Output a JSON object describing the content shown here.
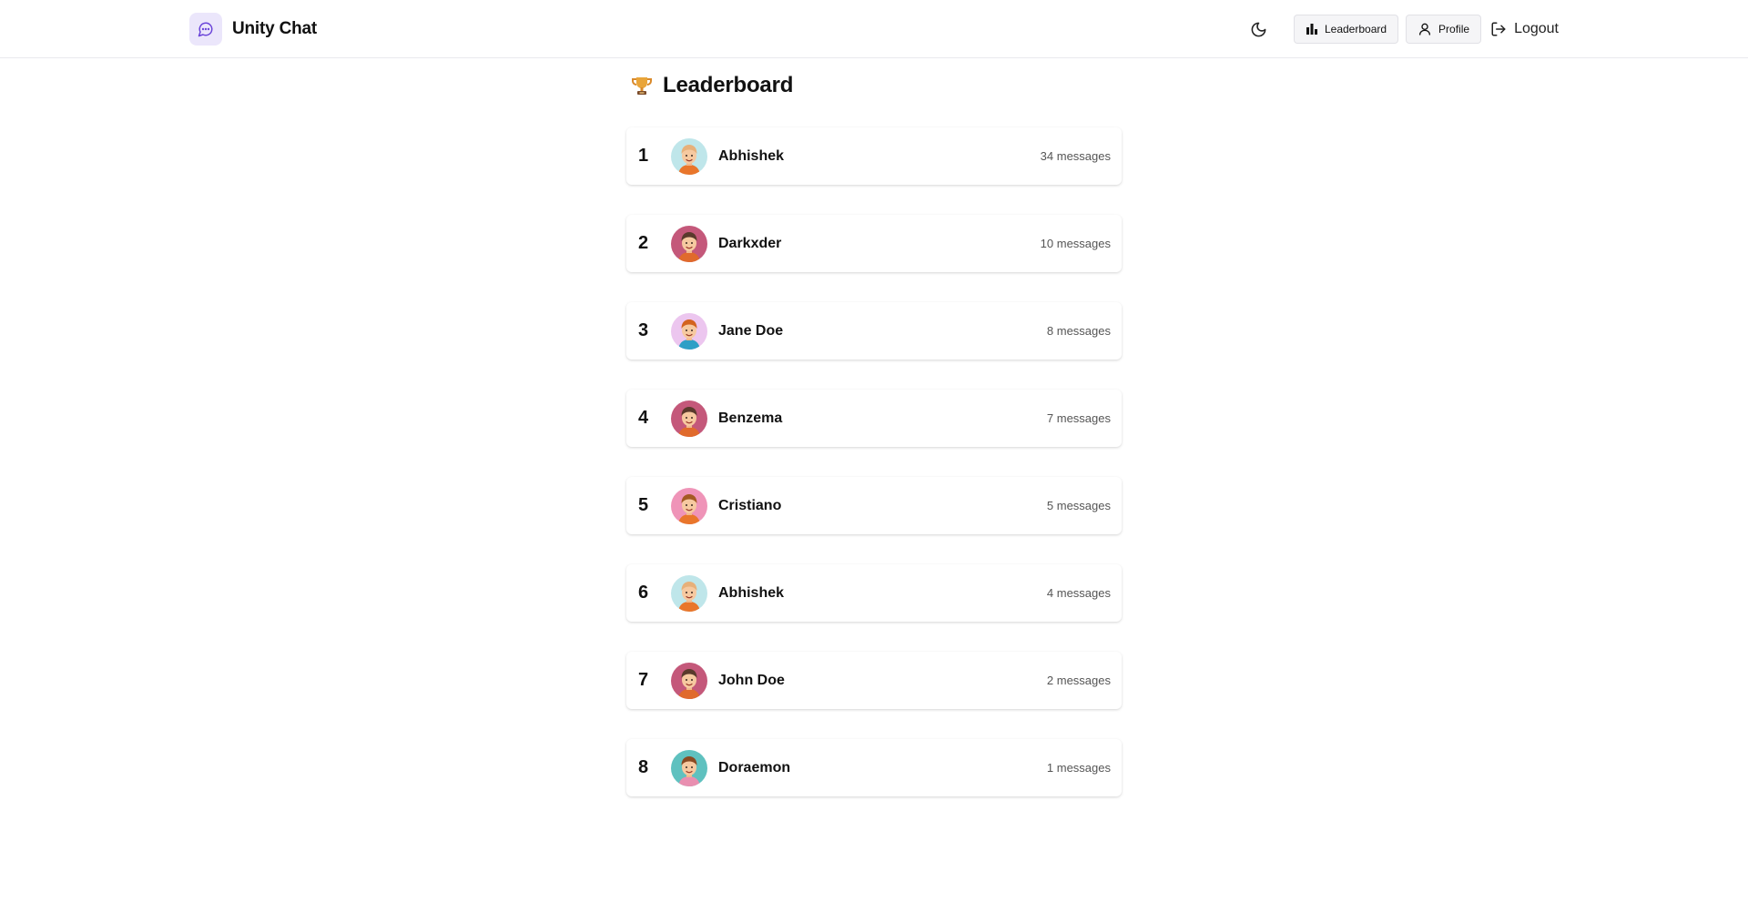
{
  "app": {
    "name": "Unity Chat"
  },
  "nav": {
    "leaderboard_label": "Leaderboard",
    "profile_label": "Profile",
    "logout_label": "Logout"
  },
  "page": {
    "title": "Leaderboard"
  },
  "entries": [
    {
      "rank": "1",
      "name": "Abhishek",
      "messages": "34 messages",
      "avatar_bg": "#bfe6ea",
      "hair": "#e7b07a",
      "shirt": "#e9762b"
    },
    {
      "rank": "2",
      "name": "Darkxder",
      "messages": "10 messages",
      "avatar_bg": "#c4587a",
      "hair": "#5a3a2c",
      "shirt": "#e06a2c"
    },
    {
      "rank": "3",
      "name": "Jane Doe",
      "messages": "8 messages",
      "avatar_bg": "#ecc6ef",
      "hair": "#d3631f",
      "shirt": "#2e9fc6"
    },
    {
      "rank": "4",
      "name": "Benzema",
      "messages": "7 messages",
      "avatar_bg": "#c4587a",
      "hair": "#5a3a2c",
      "shirt": "#e06a2c"
    },
    {
      "rank": "5",
      "name": "Cristiano",
      "messages": "5 messages",
      "avatar_bg": "#ef94b8",
      "hair": "#a45a22",
      "shirt": "#e9762b"
    },
    {
      "rank": "6",
      "name": "Abhishek",
      "messages": "4 messages",
      "avatar_bg": "#bfe6ea",
      "hair": "#e7b07a",
      "shirt": "#e9762b"
    },
    {
      "rank": "7",
      "name": "John Doe",
      "messages": "2 messages",
      "avatar_bg": "#c4587a",
      "hair": "#5a3a2c",
      "shirt": "#e06a2c"
    },
    {
      "rank": "8",
      "name": "Doraemon",
      "messages": "1 messages",
      "avatar_bg": "#5fc1bf",
      "hair": "#8a4a22",
      "shirt": "#e98fb0"
    }
  ]
}
